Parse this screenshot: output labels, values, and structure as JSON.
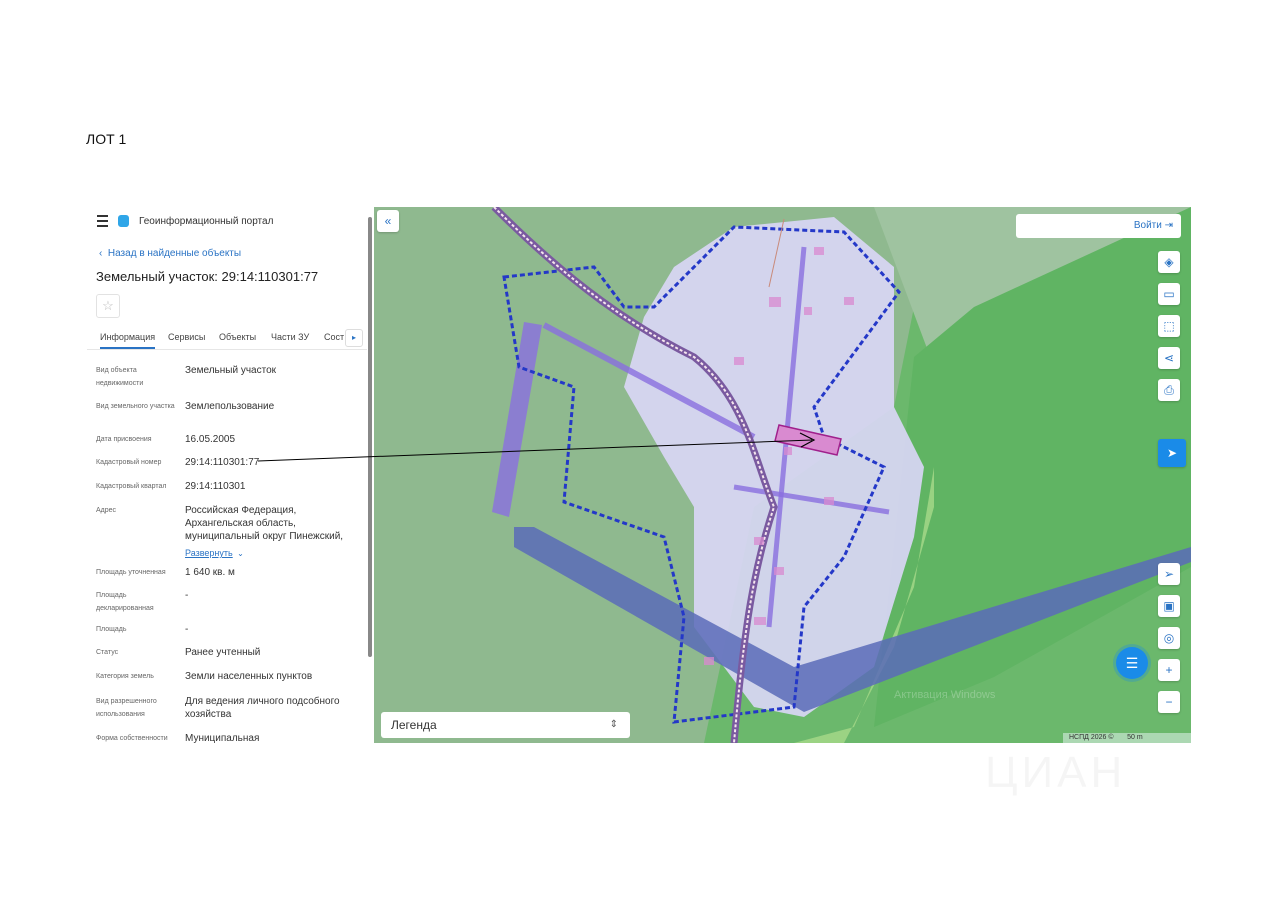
{
  "page_label": "ЛОТ 1",
  "panel": {
    "app_title": "Геоинформационный портал",
    "back_link": "Назад в найденные объекты",
    "object_title": "Земельный участок: 29:14:110301:77",
    "tabs": [
      "Информация",
      "Сервисы",
      "Объекты",
      "Части ЗУ",
      "Состав"
    ],
    "fields": [
      {
        "label": "Вид объекта недвижимости",
        "value": "Земельный участок"
      },
      {
        "label": "Вид земельного участка",
        "value": "Землепользование"
      },
      {
        "label": "Дата присвоения",
        "value": "16.05.2005"
      },
      {
        "label": "Кадастровый номер",
        "value": "29:14:110301:77"
      },
      {
        "label": "Кадастровый квартал",
        "value": "29:14:110301"
      },
      {
        "label": "Адрес",
        "value": "Российская Федерация, Архангельская область, муниципальный округ Пинежский,"
      },
      {
        "label": "Площадь уточненная",
        "value": "1 640 кв. м"
      },
      {
        "label": "Площадь декларированная",
        "value": "-"
      },
      {
        "label": "Площадь",
        "value": "-"
      },
      {
        "label": "Статус",
        "value": "Ранее учтенный"
      },
      {
        "label": "Категория земель",
        "value": "Земли населенных пунктов"
      },
      {
        "label": "Вид разрешенного использования",
        "value": "Для ведения личного подсобного хозяйства"
      },
      {
        "label": "Форма собственности",
        "value": "Муниципальная"
      }
    ],
    "expand_link": "Развернуть"
  },
  "map": {
    "login": "Войти",
    "legend": "Легенда",
    "attribution": "НСПД 2026 ©",
    "scale": "50 m",
    "windows_watermark": "Активация Windows",
    "colors": {
      "forest": "#6bb86c",
      "settlement": "#d9d6f5",
      "boundary": "#2438c8",
      "zone": "#8a6fe0",
      "parcel": "#d98ad0"
    }
  },
  "watermark_logo": "ЦИАН"
}
